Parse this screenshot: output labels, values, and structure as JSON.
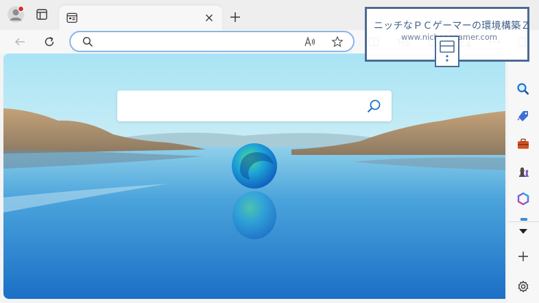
{
  "tabs": [
    {
      "title": "",
      "active": true
    }
  ],
  "icons": {
    "profile": "profile-avatar-icon",
    "workspaces": "tab-actions-icon",
    "favicon": "new-tab-page-icon",
    "tab_close": "close-icon",
    "new_tab": "plus-icon",
    "back": "arrow-left-icon",
    "refresh": "refresh-icon",
    "search": "search-icon",
    "read_aloud": "read-aloud-icon",
    "favorite": "star-icon",
    "split": "split-screen-icon",
    "favorites": "favorites-list-icon",
    "collections": "collections-icon",
    "extensions": "extensions-icon",
    "menu": "more-icon",
    "sidebar_toggle": "sidebar-icon"
  },
  "address_bar": {
    "value": "",
    "placeholder": ""
  },
  "ntp": {
    "search_value": "",
    "search_placeholder": ""
  },
  "sidebar": {
    "items": [
      {
        "name": "search",
        "icon": "search-icon",
        "color": "#1a73c8"
      },
      {
        "name": "shopping",
        "icon": "tag-icon",
        "color": "#3b6fd4"
      },
      {
        "name": "tools",
        "icon": "toolbox-icon",
        "color": "#d2541f"
      },
      {
        "name": "games",
        "icon": "chess-icon",
        "color": "#4a4a4a"
      },
      {
        "name": "microsoft-365",
        "icon": "m365-icon",
        "color": "#7b5ce0"
      }
    ],
    "more": "chevron-down-icon",
    "add": "plus-icon",
    "settings": "gear-icon"
  },
  "watermark": {
    "title": "ニッチなＰＣゲーマーの環境構築Ｚ",
    "url": "www.nichepcgamer.com"
  },
  "colors": {
    "titlebar": "#eeeeee",
    "toolbar": "#f7f7f7",
    "address_border": "#8ab4e8",
    "accent": "#1a73c8",
    "watermark_border": "#4a6a94"
  }
}
